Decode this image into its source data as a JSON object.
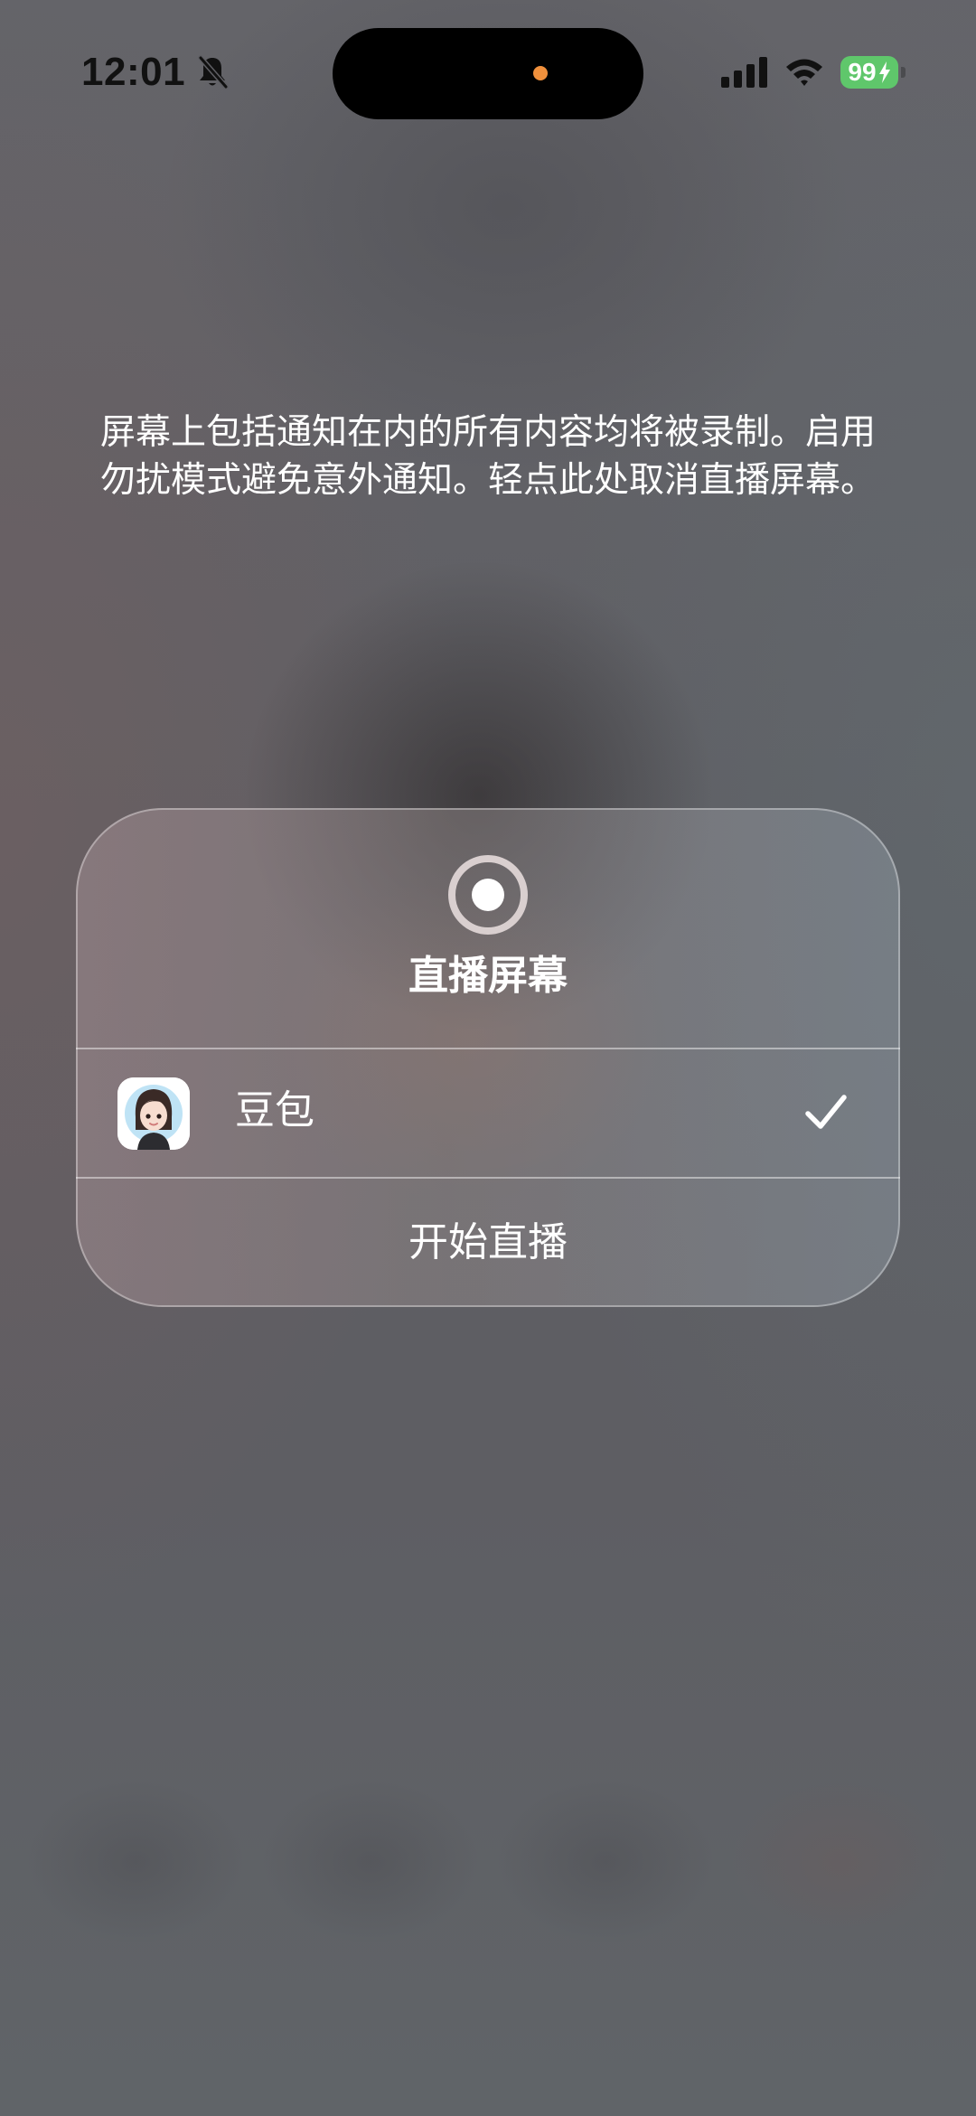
{
  "status_bar": {
    "time": "12:01",
    "silent_icon": "bell-slash-icon",
    "signal_icon": "cellular-signal-icon",
    "wifi_icon": "wifi-icon",
    "battery_level": "99",
    "battery_charging_icon": "bolt-icon",
    "battery_color": "#5fc76b",
    "recording_indicator_color": "#f0903c"
  },
  "notice": {
    "text": "屏幕上包括通知在内的所有内容均将被录制。启用勿扰模式避免意外通知。轻点此处取消直播屏幕。"
  },
  "broadcast_card": {
    "icon": "screen-record-icon",
    "title": "直播屏幕",
    "app": {
      "name": "豆包",
      "icon": "doubao-app-icon",
      "selected": true,
      "check_icon": "checkmark-icon"
    },
    "start_label": "开始直播"
  }
}
